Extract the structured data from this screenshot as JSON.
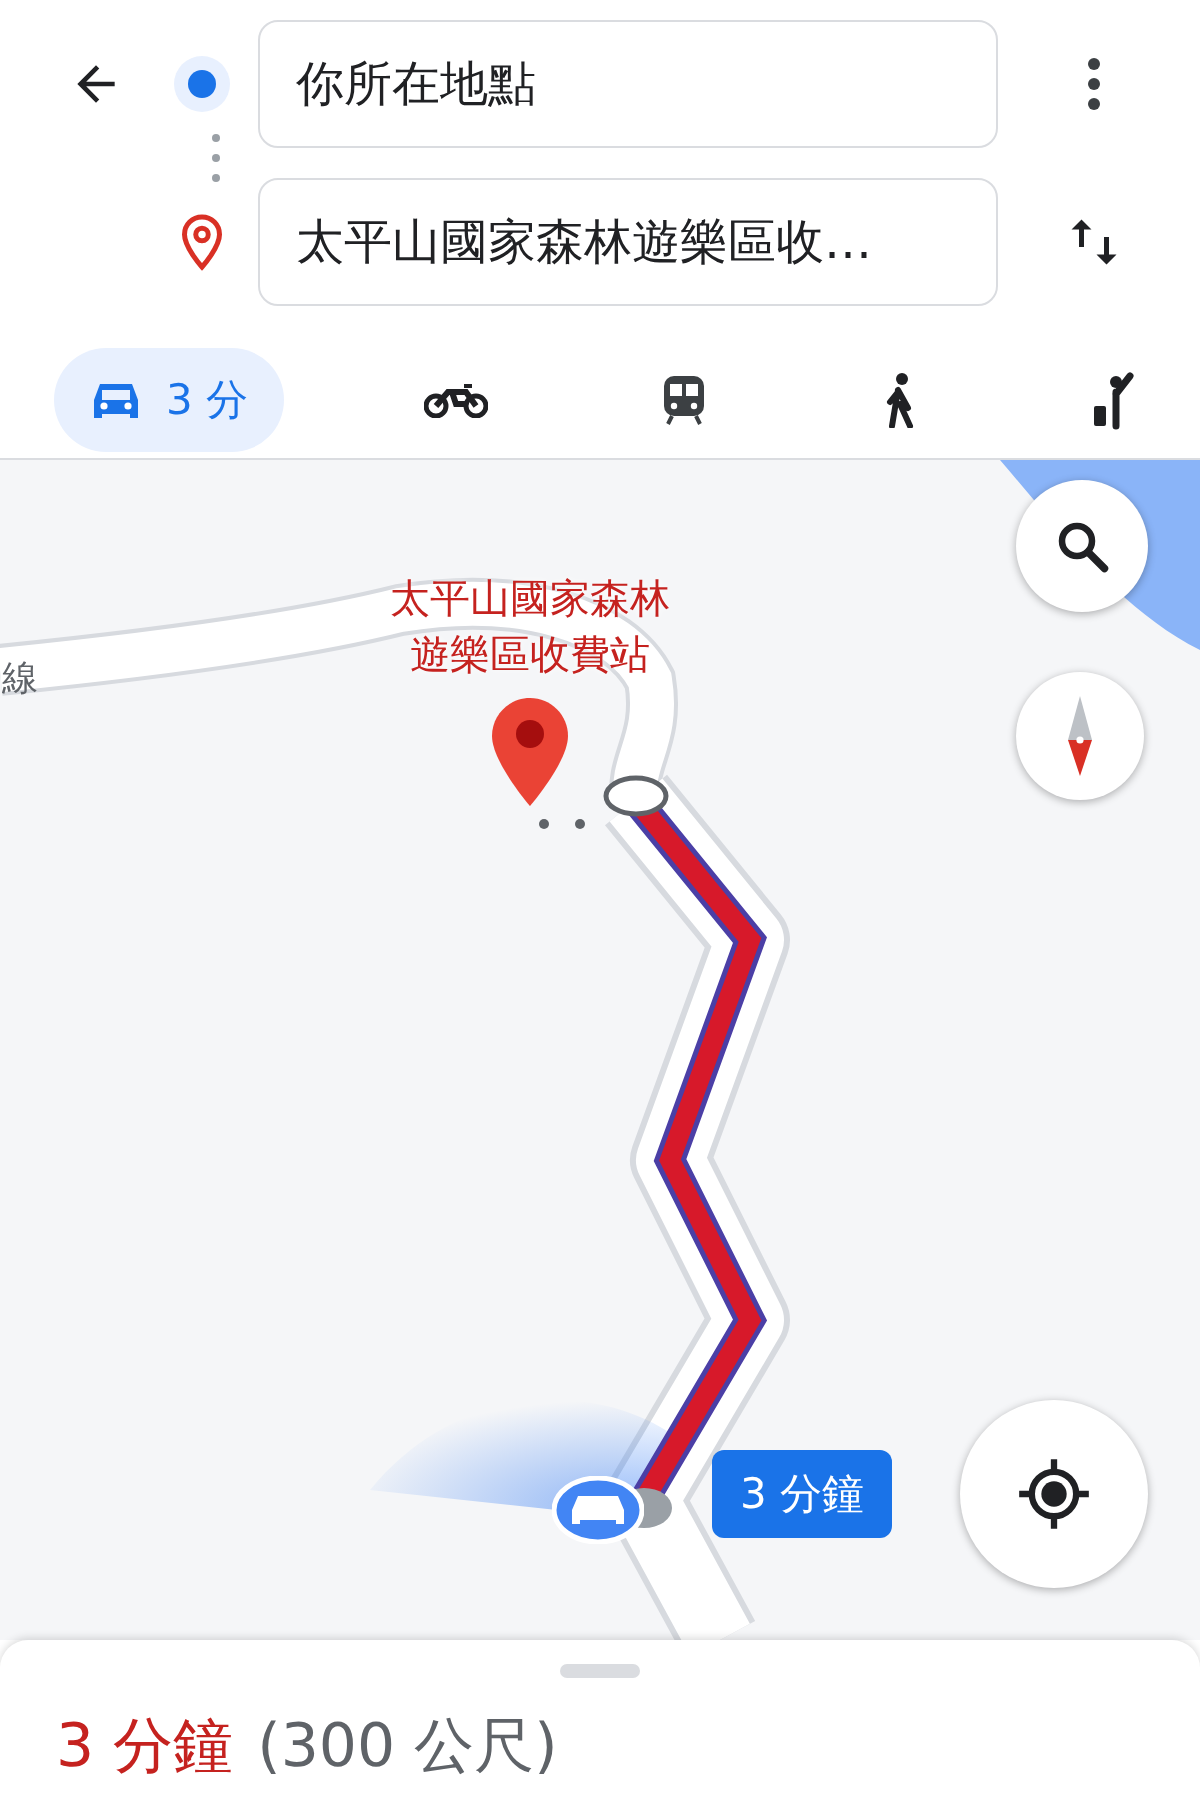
{
  "origin": {
    "value": "你所在地點"
  },
  "destination": {
    "value": "太平山國家森林遊樂區收…"
  },
  "travel_modes": [
    {
      "kind": "car",
      "label": "3 分",
      "selected": true
    },
    {
      "kind": "motorcycle",
      "selected": false
    },
    {
      "kind": "transit",
      "selected": false
    },
    {
      "kind": "walk",
      "selected": false
    },
    {
      "kind": "rideshare",
      "selected": false
    }
  ],
  "map": {
    "road_label": "線",
    "place_label": [
      "太平山國家森林",
      "遊樂區收費站"
    ],
    "route_label": "3 分鐘"
  },
  "summary": {
    "duration": "3 分鐘",
    "distance": "(300 公尺)"
  }
}
